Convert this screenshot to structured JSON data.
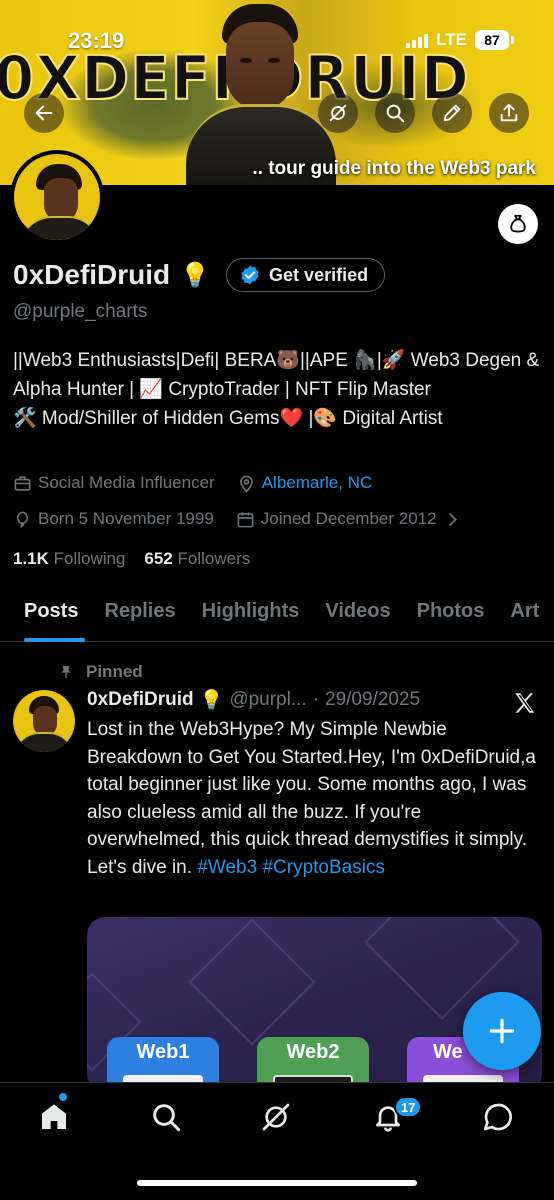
{
  "status_bar": {
    "time": "23:19",
    "network": "LTE",
    "battery": "87"
  },
  "banner": {
    "title_text": "0XDEFI DRUID",
    "tagline": ".. tour guide into the Web3 park"
  },
  "header_buttons": {
    "back": "back-arrow-icon",
    "grok": "grok-icon",
    "search": "search-icon",
    "edit": "pencil-icon",
    "share": "share-icon"
  },
  "profile": {
    "name": "0xDefiDruid",
    "name_emoji": "💡",
    "verify_label": "Get verified",
    "handle": "@purple_charts",
    "bio": "||Web3 Enthusiasts|Defi| BERA🐻||APE 🦍|🚀 Web3 Degen & Alpha Hunter | 📈 CryptoTrader | NFT Flip Master\n🛠️ Mod/Shiller of Hidden Gems❤️ |🎨 Digital Artist",
    "category": "Social Media Influencer",
    "location": "Albemarle, NC",
    "birthday": "Born 5 November 1999",
    "joined": "Joined December 2012",
    "following_count": "1.1K",
    "following_label": "Following",
    "followers_count": "652",
    "followers_label": "Followers"
  },
  "tabs": [
    "Posts",
    "Replies",
    "Highlights",
    "Videos",
    "Photos",
    "Art"
  ],
  "pinned_tweet": {
    "pinned_label": "Pinned",
    "name": "0xDefiDruid",
    "name_emoji": "💡",
    "handle": "@purpl...",
    "separator": "·",
    "date": "29/09/2025",
    "text": "Lost in the Web3Hype? My Simple Newbie Breakdown to Get You Started.Hey, I'm 0xDefiDruid,a total beginner just like you. Some months ago, I was also clueless amid all the buzz. If you're overwhelmed, this quick thread demystifies it simply. Let's dive in.",
    "hashtags": [
      "#Web3",
      "#CryptoBasics"
    ],
    "media_cards": [
      {
        "label": "Web1",
        "color": "#2f7fe0"
      },
      {
        "label": "Web2",
        "color": "#4fa055"
      },
      {
        "label": "We",
        "color": "#8a4fd8"
      }
    ]
  },
  "bottom_nav": {
    "items": [
      "home-icon",
      "search-icon",
      "grok-icon",
      "notifications-icon",
      "messages-icon"
    ],
    "notification_count": "17"
  },
  "colors": {
    "accent": "#1d9bf0",
    "background": "#000000",
    "muted": "#71767b",
    "text": "#e7e9ea"
  }
}
